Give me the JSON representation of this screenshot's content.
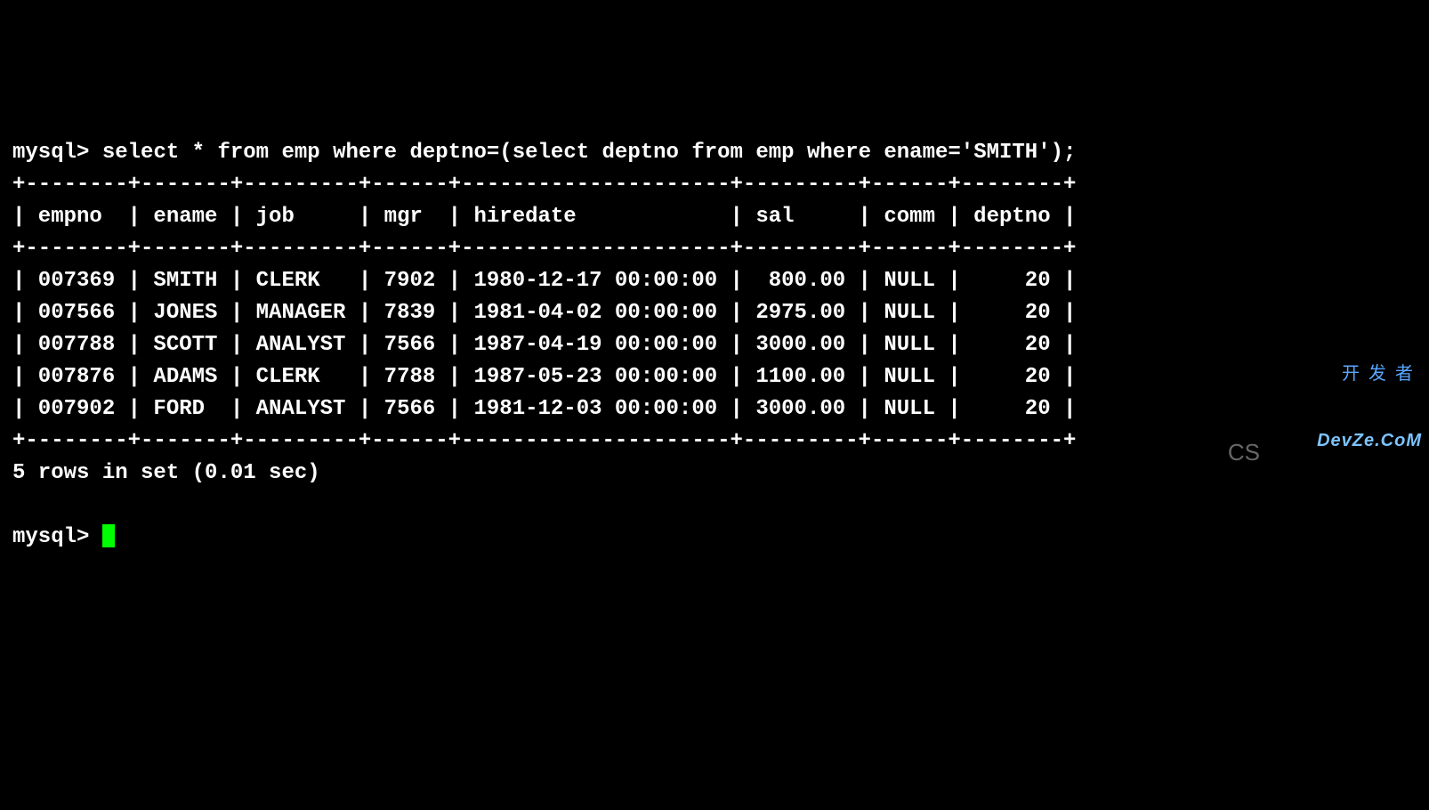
{
  "prompt": "mysql> ",
  "query": "select * from emp where deptno=(select deptno from emp where ename='SMITH');",
  "border_top": "+--------+-------+---------+------+---------------------+---------+------+--------+",
  "header_line": "| empno  | ename | job     | mgr  | hiredate            | sal     | comm | deptno |",
  "border_mid": "+--------+-------+---------+------+---------------------+---------+------+--------+",
  "rows": [
    "| 007369 | SMITH | CLERK   | 7902 | 1980-12-17 00:00:00 |  800.00 | NULL |     20 |",
    "| 007566 | JONES | MANAGER | 7839 | 1981-04-02 00:00:00 | 2975.00 | NULL |     20 |",
    "| 007788 | SCOTT | ANALYST | 7566 | 1987-04-19 00:00:00 | 3000.00 | NULL |     20 |",
    "| 007876 | ADAMS | CLERK   | 7788 | 1987-05-23 00:00:00 | 1100.00 | NULL |     20 |",
    "| 007902 | FORD  | ANALYST | 7566 | 1981-12-03 00:00:00 | 3000.00 | NULL |     20 |"
  ],
  "border_bot": "+--------+-------+---------+------+---------------------+---------+------+--------+",
  "summary": "5 rows in set (0.01 sec)",
  "prompt2": "mysql> ",
  "watermark_cn": "开发者",
  "watermark_en": "DevZe.CoM",
  "cs_text": "CS",
  "chart_data": {
    "type": "table",
    "columns": [
      "empno",
      "ename",
      "job",
      "mgr",
      "hiredate",
      "sal",
      "comm",
      "deptno"
    ],
    "data": [
      {
        "empno": "007369",
        "ename": "SMITH",
        "job": "CLERK",
        "mgr": 7902,
        "hiredate": "1980-12-17 00:00:00",
        "sal": 800.0,
        "comm": null,
        "deptno": 20
      },
      {
        "empno": "007566",
        "ename": "JONES",
        "job": "MANAGER",
        "mgr": 7839,
        "hiredate": "1981-04-02 00:00:00",
        "sal": 2975.0,
        "comm": null,
        "deptno": 20
      },
      {
        "empno": "007788",
        "ename": "SCOTT",
        "job": "ANALYST",
        "mgr": 7566,
        "hiredate": "1987-04-19 00:00:00",
        "sal": 3000.0,
        "comm": null,
        "deptno": 20
      },
      {
        "empno": "007876",
        "ename": "ADAMS",
        "job": "CLERK",
        "mgr": 7788,
        "hiredate": "1987-05-23 00:00:00",
        "sal": 1100.0,
        "comm": null,
        "deptno": 20
      },
      {
        "empno": "007902",
        "ename": "FORD",
        "job": "ANALYST",
        "mgr": 7566,
        "hiredate": "1981-12-03 00:00:00",
        "sal": 3000.0,
        "comm": null,
        "deptno": 20
      }
    ]
  }
}
